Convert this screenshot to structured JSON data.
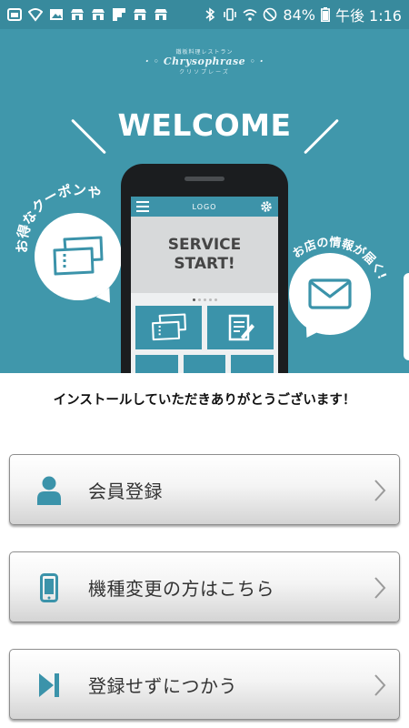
{
  "status_bar": {
    "battery": "84%",
    "time": "午後 1:16",
    "left_icons": [
      "image-icon",
      "wifi-shield-icon",
      "gallery-icon",
      "store-icon",
      "store-icon",
      "flipboard-icon",
      "store-icon",
      "store-icon"
    ],
    "right_icons": [
      "bluetooth-icon",
      "vibrate-icon",
      "wifi-icon",
      "no-sim-icon"
    ]
  },
  "hero": {
    "brand_sub": "鐵板料理レストラン",
    "brand_name": "Chrysophrase",
    "brand_kana": "クリソプレーズ",
    "welcome": "WELCOME",
    "left_bubble_caption": "お得なクーポンや",
    "right_bubble_caption": "お店の情報が届く!",
    "phone": {
      "app_logo": "LOGO",
      "service_line1": "SERVICE",
      "service_line2": "START!",
      "page_dots": 5,
      "active_dot": 0
    }
  },
  "message": "インストールしていただきありがとうございます！",
  "buttons": [
    {
      "label": "会員登録",
      "icon": "person-icon"
    },
    {
      "label": "機種変更の方はこちら",
      "icon": "smartphone-icon"
    },
    {
      "label": "登録せずにつかう",
      "icon": "skip-icon"
    }
  ],
  "colors": {
    "status_bar": "#388a9d",
    "hero_bg": "#4097ab",
    "accent": "#3b93aa"
  }
}
